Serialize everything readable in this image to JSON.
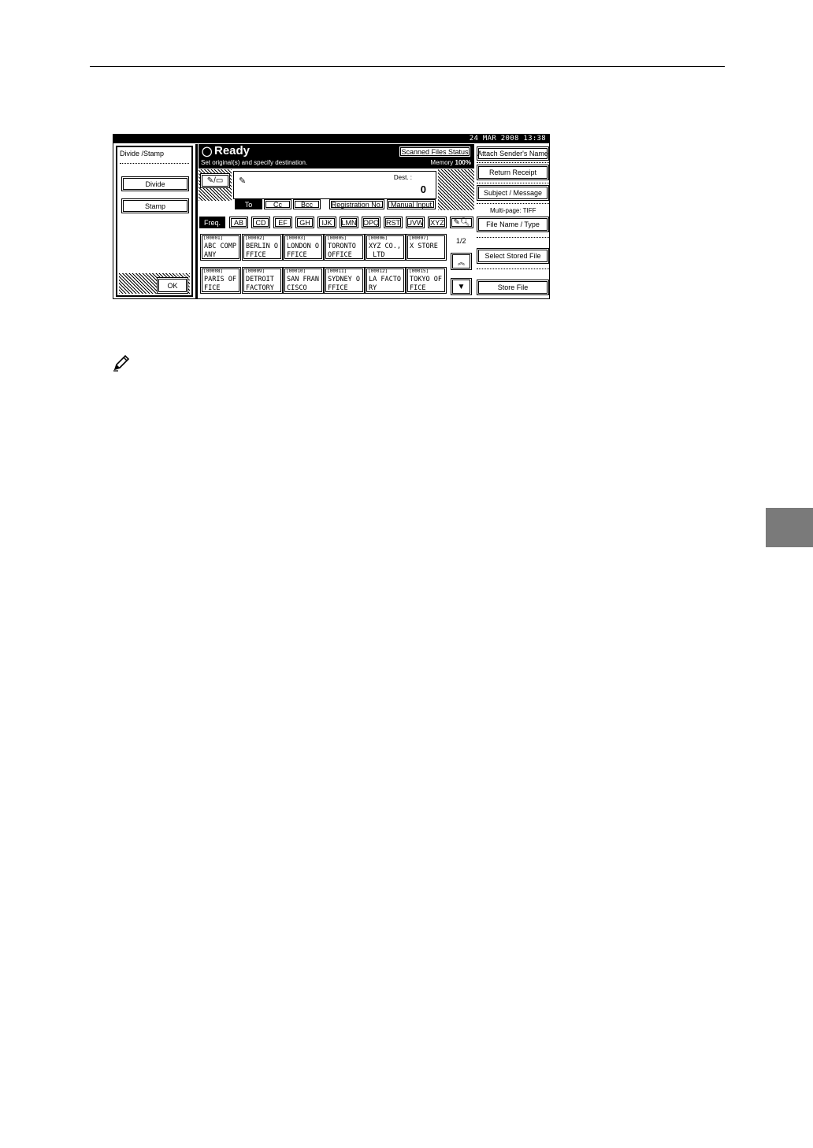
{
  "screen": {
    "datetime": "24 MAR  2008 13:38",
    "left_panel": {
      "title": "Divide /Stamp",
      "divide_label": "Divide",
      "stamp_label": "Stamp",
      "ok_label": "OK"
    },
    "status": {
      "title": "Ready",
      "instruction": "Set original(s) and specify destination.",
      "memory_label": "Memory",
      "memory_value": "100%"
    },
    "scanned_files_label": "Scanned Files Status",
    "dest": {
      "label": "Dest. :",
      "count": "0"
    },
    "dest_type_tabs": [
      "To",
      "Cc",
      "Bcc",
      "Registration No.",
      "Manual Input"
    ],
    "index_tabs": [
      "Freq.",
      "AB",
      "CD",
      "EF",
      "GH",
      "IJK",
      "LMN",
      "OPQ",
      "RST",
      "UVW",
      "XYZ"
    ],
    "directory": [
      {
        "id": "[00001]",
        "line1": "ABC COMP",
        "line2": "ANY"
      },
      {
        "id": "[00002]",
        "line1": "BERLIN O",
        "line2": "FFICE"
      },
      {
        "id": "[00003]",
        "line1": "LONDON O",
        "line2": "FFICE"
      },
      {
        "id": "[00005]",
        "line1": "TORONTO",
        "line2": "OFFICE"
      },
      {
        "id": "[00006]",
        "line1": "XYZ CO.,",
        "line2": " LTD"
      },
      {
        "id": "[00007]",
        "line1": "X STORE",
        "line2": ""
      },
      {
        "id": "[00008]",
        "line1": "PARIS OF",
        "line2": "FICE"
      },
      {
        "id": "[00009]",
        "line1": "DETROIT",
        "line2": "FACTORY"
      },
      {
        "id": "[00010]",
        "line1": "SAN FRAN",
        "line2": "CISCO"
      },
      {
        "id": "[00011]",
        "line1": "SYDNEY O",
        "line2": "FFICE"
      },
      {
        "id": "[00012]",
        "line1": "LA FACTO",
        "line2": "RY"
      },
      {
        "id": "[00015]",
        "line1": "TOKYO OF",
        "line2": "FICE"
      }
    ],
    "page_indicator": "1/2",
    "right_panel": {
      "attach_sender": "Attach Sender's Name",
      "return_receipt": "Return Receipt",
      "subject_message": "Subject / Message",
      "multipage_label": "Multi-page: TIFF",
      "file_name_type": "File Name / Type",
      "select_stored_file": "Select Stored File",
      "store_file": "Store File"
    }
  }
}
